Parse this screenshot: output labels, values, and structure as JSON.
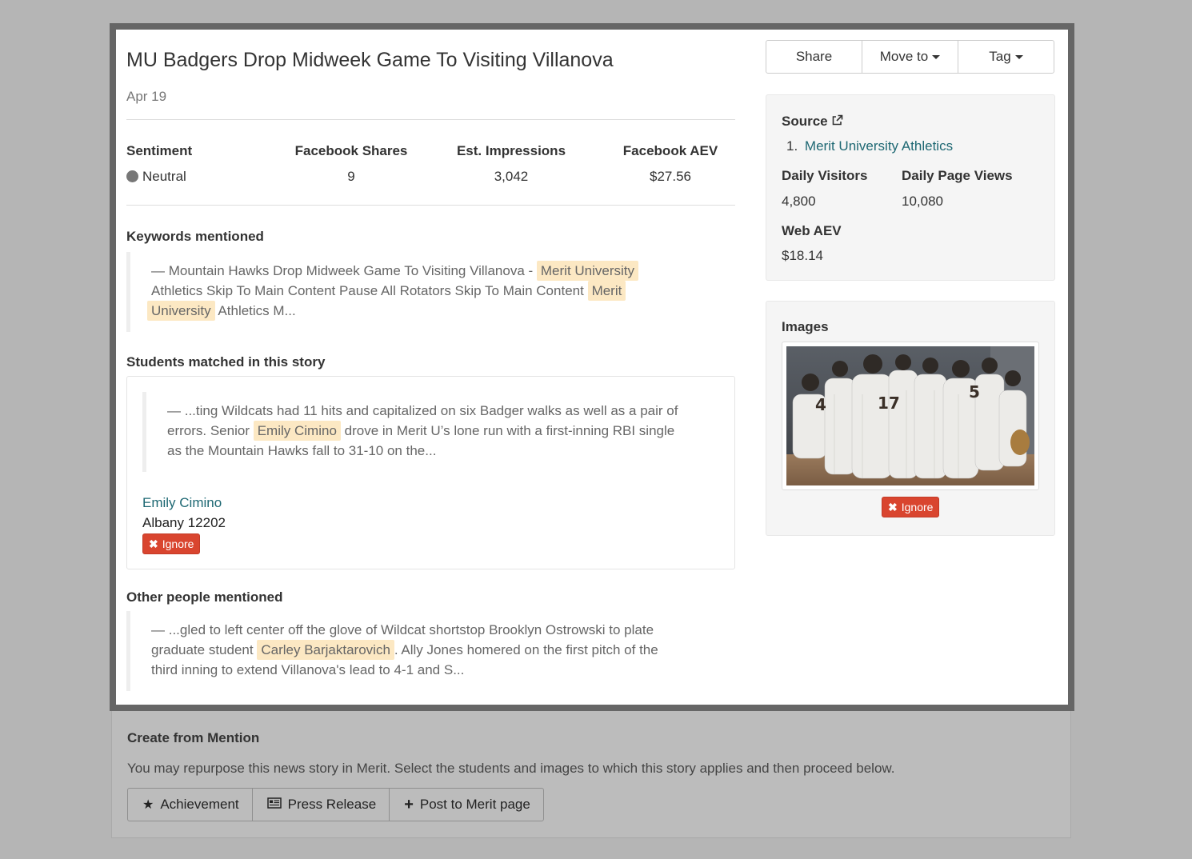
{
  "story": {
    "title": "MU Badgers Drop Midweek Game To Visiting Villanova",
    "date": "Apr 19"
  },
  "stats": [
    {
      "label": "Sentiment",
      "value": "Neutral"
    },
    {
      "label": "Facebook Shares",
      "value": "9"
    },
    {
      "label": "Est. Impressions",
      "value": "3,042"
    },
    {
      "label": "Facebook AEV",
      "value": "$27.56"
    }
  ],
  "keywords": {
    "title": "Keywords mentioned",
    "seg1": "— Mountain Hawks Drop Midweek Game To Visiting Villanova -",
    "hl1": "Merit University",
    "seg2": "Athletics Skip To Main Content Pause All Rotators Skip To Main Content",
    "hl2a": "Merit",
    "hl2b": "University",
    "seg3": "Athletics M..."
  },
  "students": {
    "title": "Students matched in this story",
    "seg1": "— ...ting Wildcats had 11 hits and capitalized on six Badger walks as well as a pair of",
    "seg2": "errors.   Senior",
    "hl": "Emily Cimino",
    "seg3": "drove in Merit U’s lone run with a first-inning RBI single",
    "seg4": "as the Mountain Hawks fall to 31-10 on the...",
    "name": "Emily Cimino",
    "location": "Albany 12202",
    "ignore_label": "Ignore"
  },
  "others": {
    "title": "Other people mentioned",
    "seg1": "— ...gled to left center off the glove of Wildcat shortstop Brooklyn Ostrowski to plate",
    "seg2": "graduate student",
    "hl": "Carley Barjaktarovich",
    "seg3": ".   Ally Jones homered on the first pitch of the",
    "seg4": "third inning to extend Villanova's lead to 4-1 and S..."
  },
  "actions": {
    "share": "Share",
    "move_to": "Move to",
    "tag": "Tag"
  },
  "source": {
    "title": "Source",
    "index": "1.",
    "name": "Merit University Athletics",
    "daily_visitors_label": "Daily Visitors",
    "daily_visitors": "4,800",
    "daily_page_views_label": "Daily Page Views",
    "daily_page_views": "10,080",
    "web_aev_label": "Web AEV",
    "web_aev": "$18.14"
  },
  "images": {
    "title": "Images",
    "ignore_label": "Ignore",
    "jersey_numbers": [
      "4",
      "17",
      "5"
    ]
  },
  "create": {
    "title": "Create from Mention",
    "description": "You may repurpose this news story in Merit. Select the students and images to which this story applies and then proceed below.",
    "buttons": [
      "Achievement",
      "Press Release",
      "Post to Merit page"
    ]
  },
  "colors": {
    "link": "#1e6873",
    "highlight": "#fce8c3",
    "danger": "#d9452f"
  }
}
